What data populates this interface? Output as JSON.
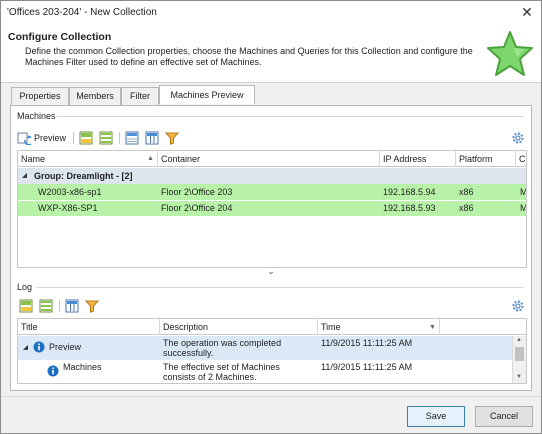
{
  "window": {
    "title": "'Offices 203-204' - New Collection",
    "close_glyph": "✕"
  },
  "header": {
    "title": "Configure Collection",
    "description": "Define the common Collection properties, choose the Machines and Queries for this Collection and configure the Machines Filter used to define an effective set of Machines.",
    "icon": "green-star-icon"
  },
  "tabs": [
    {
      "label": "Properties",
      "active": false
    },
    {
      "label": "Members",
      "active": false
    },
    {
      "label": "Filter",
      "active": false
    },
    {
      "label": "Machines Preview",
      "active": true
    }
  ],
  "machines": {
    "group_title": "Machines",
    "toolbar": {
      "preview_label": "Preview"
    },
    "columns": [
      "Name",
      "Container",
      "IP Address",
      "Platform",
      "C"
    ],
    "group_row": "Group: Dreamlight - [2]",
    "rows": [
      {
        "name": "W2003-x86-sp1",
        "container": "Floor 2\\Office 203",
        "ip": "192.168.5.94",
        "platform": "x86",
        "extra": "M"
      },
      {
        "name": "WXP-X86-SP1",
        "container": "Floor 2\\Office 204",
        "ip": "192.168.5.93",
        "platform": "x86",
        "extra": "M"
      }
    ],
    "row_color": "#b8f2a8",
    "group_color": "#dde6ef"
  },
  "splitter_glyph": "⌄",
  "log": {
    "group_title": "Log",
    "columns": [
      "Title",
      "Description",
      "Time"
    ],
    "rows": [
      {
        "title": "Preview",
        "description": "The operation was completed successfully.",
        "time": "11/9/2015 11:11:25 AM",
        "expand_glyph": "◢"
      },
      {
        "title": "Machines",
        "description": "The effective set of Machines consists of 2 Machines.",
        "time": "11/9/2015 11:11:25 AM"
      }
    ]
  },
  "buttons": {
    "save": "Save",
    "cancel": "Cancel"
  },
  "colors": {
    "accent_blue": "#1d6fc2",
    "selection": "#dbe9f7"
  }
}
